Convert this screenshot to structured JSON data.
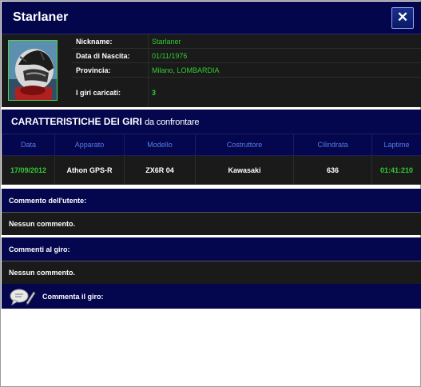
{
  "window": {
    "title": "Starlaner",
    "close_label": "✕"
  },
  "profile": {
    "fields": [
      {
        "label": "Nickname:",
        "value": "Starlaner"
      },
      {
        "label": "Data di Nascita:",
        "value": "01/11/1976"
      },
      {
        "label": "Provincia:",
        "value": "Milano, LOMBARDIA"
      },
      {
        "label": "I giri caricati:",
        "value": "3"
      }
    ],
    "avatar_icon": "helmet-photo"
  },
  "laps_section": {
    "title_strong": "CARATTERISTICHE DEI GIRI",
    "title_light": "da confrontare",
    "columns": [
      "Data",
      "Apparato",
      "Modello",
      "Costruttore",
      "Cilindrata",
      "Laptime"
    ],
    "rows": [
      [
        "17/09/2012",
        "Athon GPS-R",
        "ZX6R 04",
        "Kawasaki",
        "636",
        "01:41:210"
      ]
    ]
  },
  "comments": {
    "user_comment_label": "Commento dell'utente:",
    "user_comment_text": "Nessun commento.",
    "lap_comments_label": "Commenti al giro:",
    "lap_comments_text": "Nessun commento.",
    "write_comment_label": "Commenta il giro:",
    "write_icon": "speech-bubble-pencil-icon"
  },
  "colors": {
    "header_blue": "#04074e",
    "dark_panel": "#1a1a1a",
    "accent_green": "#33cc33",
    "column_header_text": "#5a7ae6"
  }
}
